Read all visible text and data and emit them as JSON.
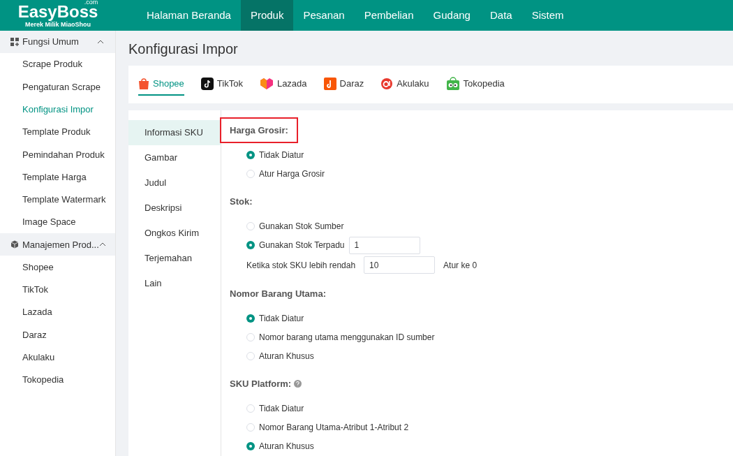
{
  "brand": {
    "name": "EasyBoss",
    "suffix": ".com",
    "tagline": "Merek Milik MiaoShou"
  },
  "top_nav": [
    {
      "label": "Halaman Beranda",
      "selected": false
    },
    {
      "label": "Produk",
      "selected": true
    },
    {
      "label": "Pesanan",
      "selected": false
    },
    {
      "label": "Pembelian",
      "selected": false
    },
    {
      "label": "Gudang",
      "selected": false
    },
    {
      "label": "Data",
      "selected": false
    },
    {
      "label": "Sistem",
      "selected": false
    }
  ],
  "sidebar": {
    "groups": [
      {
        "label": "Fungsi Umum",
        "kind": "grid",
        "expanded": true,
        "items": [
          {
            "label": "Scrape Produk",
            "selected": false
          },
          {
            "label": "Pengaturan Scrape",
            "selected": false
          },
          {
            "label": "Konfigurasi Impor",
            "selected": true
          },
          {
            "label": "Template Produk",
            "selected": false
          },
          {
            "label": "Pemindahan Produk",
            "selected": false
          },
          {
            "label": "Template Harga",
            "selected": false
          },
          {
            "label": "Template Watermark",
            "selected": false
          },
          {
            "label": "Image Space",
            "selected": false
          }
        ]
      },
      {
        "label": "Manajemen Prod...",
        "kind": "box",
        "expanded": true,
        "items": [
          {
            "label": "Shopee",
            "selected": false
          },
          {
            "label": "TikTok",
            "selected": false
          },
          {
            "label": "Lazada",
            "selected": false
          },
          {
            "label": "Daraz",
            "selected": false
          },
          {
            "label": "Akulaku",
            "selected": false
          },
          {
            "label": "Tokopedia",
            "selected": false
          }
        ]
      }
    ]
  },
  "page_title": "Konfigurasi Impor",
  "platform_tabs": [
    {
      "label": "Shopee",
      "kind": "shopee",
      "selected": true
    },
    {
      "label": "TikTok",
      "kind": "tiktok",
      "selected": false
    },
    {
      "label": "Lazada",
      "kind": "lazada",
      "selected": false
    },
    {
      "label": "Daraz",
      "kind": "daraz",
      "selected": false
    },
    {
      "label": "Akulaku",
      "kind": "akulaku",
      "selected": false
    },
    {
      "label": "Tokopedia",
      "kind": "tokopedia",
      "selected": false
    }
  ],
  "section_nav": [
    {
      "label": "Informasi SKU",
      "selected": true
    },
    {
      "label": "Gambar",
      "selected": false
    },
    {
      "label": "Judul",
      "selected": false
    },
    {
      "label": "Deskripsi",
      "selected": false
    },
    {
      "label": "Ongkos Kirim",
      "selected": false
    },
    {
      "label": "Terjemahan",
      "selected": false
    },
    {
      "label": "Lain",
      "selected": false
    }
  ],
  "sections": [
    {
      "title": "Harga Grosir:",
      "highlighted": true,
      "help": false,
      "options": [
        {
          "kind": "radio",
          "label": "Tidak Diatur",
          "selected": true
        },
        {
          "kind": "radio",
          "label": "Atur Harga Grosir",
          "selected": false
        }
      ]
    },
    {
      "title": "Stok:",
      "highlighted": false,
      "help": false,
      "options": [
        {
          "kind": "radio",
          "label": "Gunakan Stok Sumber",
          "selected": false
        },
        {
          "kind": "radio_input",
          "label": "Gunakan Stok Terpadu",
          "selected": true,
          "value": "1"
        },
        {
          "kind": "threshold",
          "label": "Ketika stok SKU lebih rendah",
          "value": "10",
          "suffix": "Atur ke 0"
        }
      ]
    },
    {
      "title": "Nomor Barang Utama:",
      "highlighted": false,
      "help": false,
      "options": [
        {
          "kind": "radio",
          "label": "Tidak Diatur",
          "selected": true
        },
        {
          "kind": "radio",
          "label": "Nomor barang utama menggunakan ID sumber",
          "selected": false
        },
        {
          "kind": "radio",
          "label": "Aturan Khusus",
          "selected": false
        }
      ]
    },
    {
      "title": "SKU Platform:",
      "highlighted": false,
      "help": true,
      "options": [
        {
          "kind": "radio",
          "label": "Tidak Diatur",
          "selected": false
        },
        {
          "kind": "radio",
          "label": "Nomor Barang Utama-Atribut 1-Atribut 2",
          "selected": false
        },
        {
          "kind": "radio",
          "label": "Aturan Khusus",
          "selected": true
        }
      ]
    }
  ]
}
